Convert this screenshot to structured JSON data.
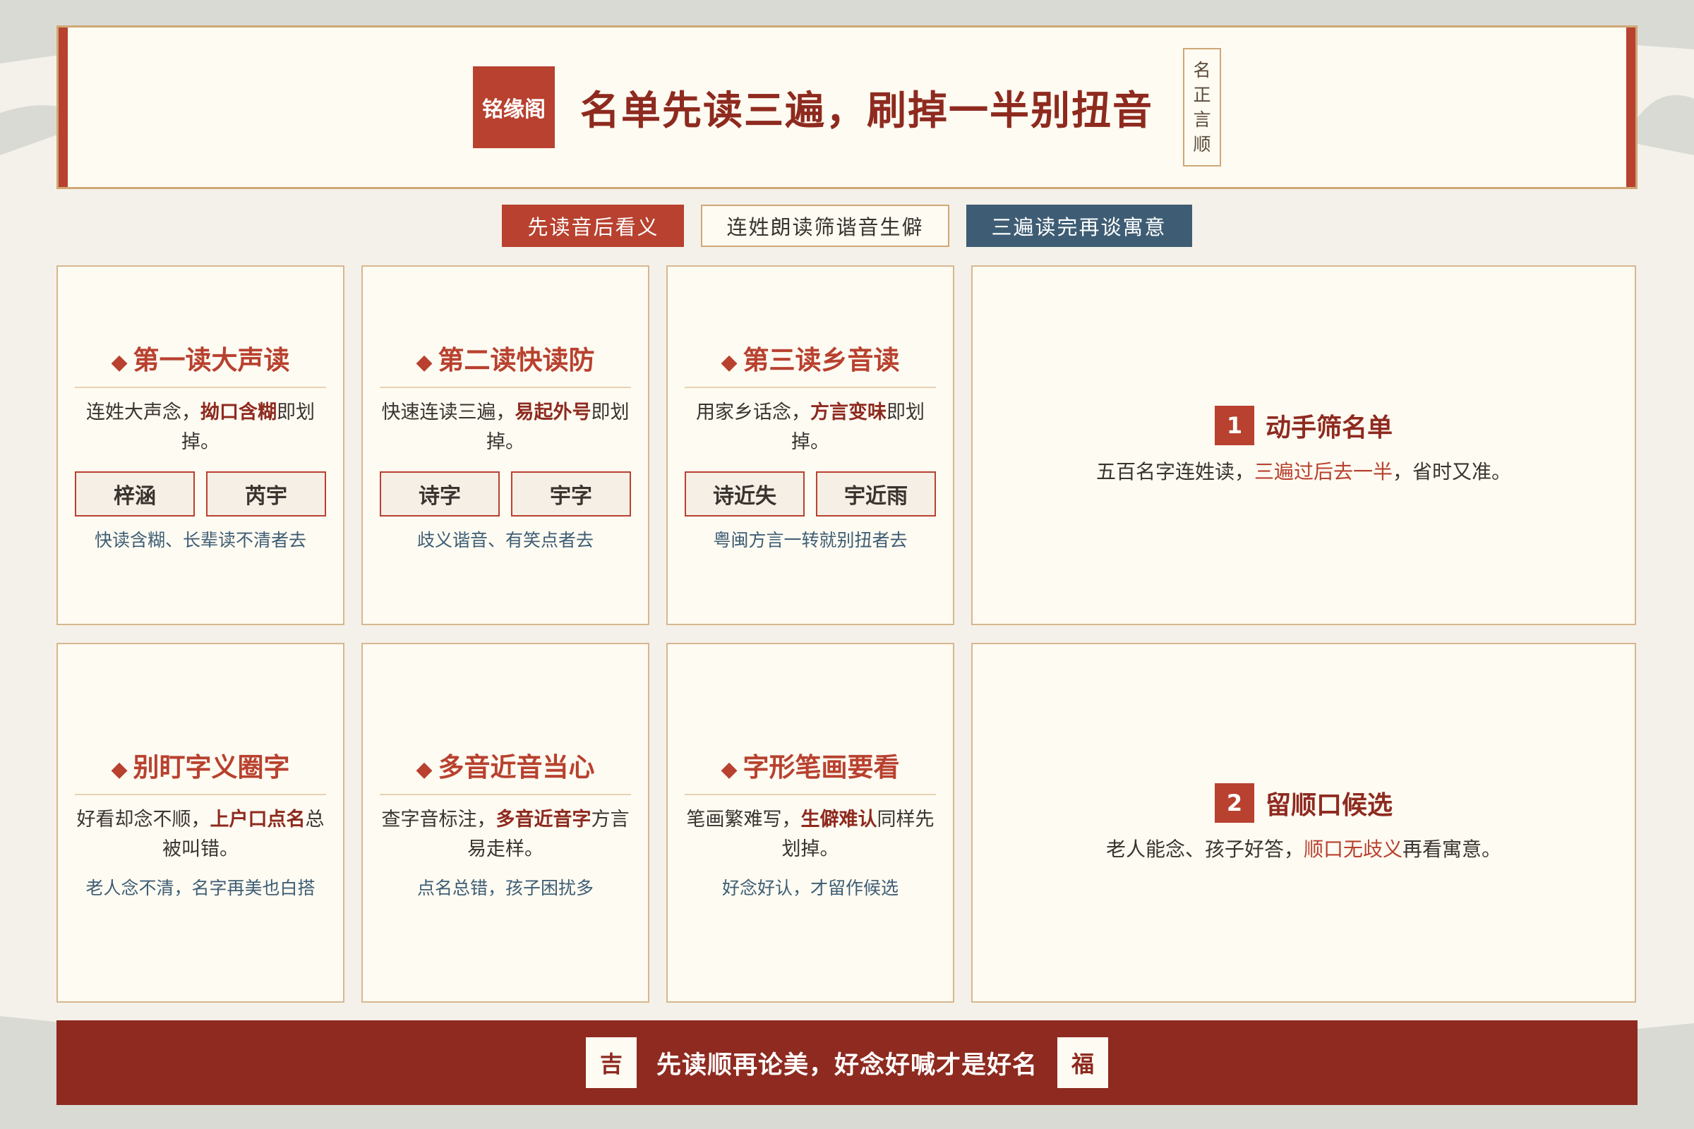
{
  "header": {
    "seal": "铭缘阁",
    "title": "名单先读三遍，刷掉一半别扭音",
    "vertical": [
      "名",
      "正",
      "言",
      "顺"
    ]
  },
  "tabs": [
    {
      "label": "先读音后看义"
    },
    {
      "label": "连姓朗读筛谐音生僻"
    },
    {
      "label": "三遍读完再谈寓意"
    }
  ],
  "cards": [
    {
      "title": "第一读大声读",
      "desc_a": "连姓大声念，",
      "desc_b": "拗口含糊",
      "desc_c": "即划掉。",
      "chips": [
        "梓涵",
        "芮宇"
      ],
      "note": "快读含糊、长辈读不清者去"
    },
    {
      "title": "第二读快读防",
      "desc_a": "快速连读三遍，",
      "desc_b": "易起外号",
      "desc_c": "即划掉。",
      "chips": [
        "诗字",
        "宇字"
      ],
      "note": "歧义谐音、有笑点者去"
    },
    {
      "title": "第三读乡音读",
      "desc_a": "用家乡话念，",
      "desc_b": "方言变味",
      "desc_c": "即划掉。",
      "chips": [
        "诗近失",
        "宇近雨"
      ],
      "note": "粤闽方言一转就别扭者去"
    },
    {
      "title": "别盯字义圈字",
      "desc_a": "好看却念不顺，",
      "desc_b": "上户口点名",
      "desc_c": "总被叫错。",
      "note": "老人念不清，名字再美也白搭"
    },
    {
      "title": "多音近音当心",
      "desc_a": "查字音标注，",
      "desc_b": "多音近音字",
      "desc_c": "方言易走样。",
      "note": "点名总错，孩子困扰多"
    },
    {
      "title": "字形笔画要看",
      "desc_a": "笔画繁难写，",
      "desc_b": "生僻难认",
      "desc_c": "同样先划掉。",
      "note": "好念好认，才留作候选"
    }
  ],
  "steps": [
    {
      "num": "1",
      "title": "动手筛名单",
      "desc_a": "五百名字连姓读，",
      "desc_b": "三遍过后去一半",
      "desc_c": "，省时又准。"
    },
    {
      "num": "2",
      "title": "留顺口候选",
      "desc_a": "老人能念、孩子好答，",
      "desc_b": "顺口无歧义",
      "desc_c": "再看寓意。"
    }
  ],
  "footer": {
    "left_seal": "吉",
    "text": "先读顺再论美，好念好喊才是好名",
    "right_seal": "福"
  }
}
